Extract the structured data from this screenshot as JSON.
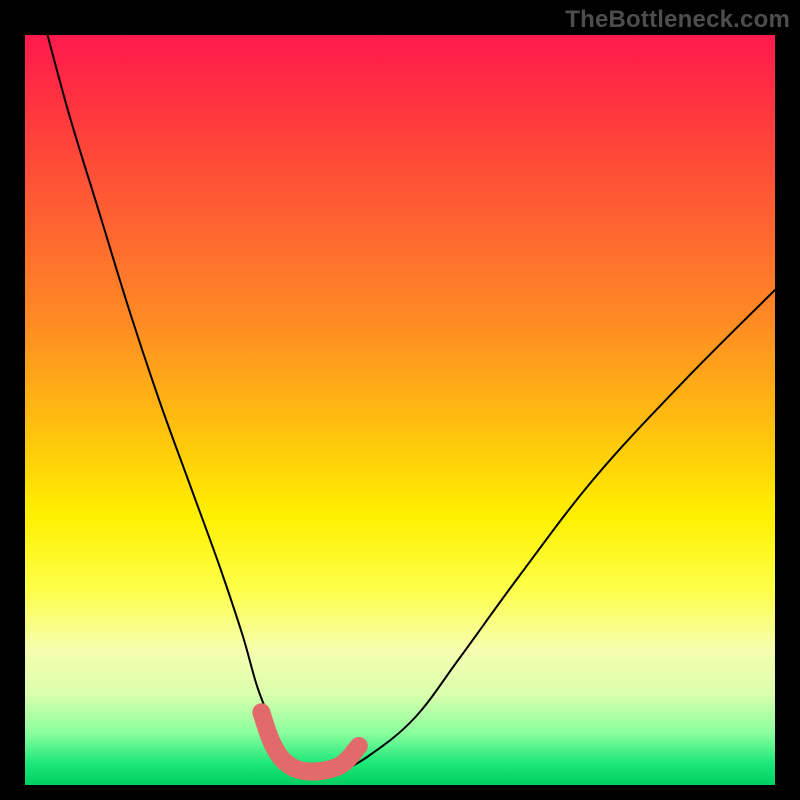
{
  "watermark": "TheBottleneck.com",
  "chart_data": {
    "type": "line",
    "title": "",
    "xlabel": "",
    "ylabel": "",
    "xlim": [
      0,
      100
    ],
    "ylim": [
      0,
      100
    ],
    "grid": false,
    "legend": false,
    "background": "vertical-rainbow-gradient",
    "series": [
      {
        "name": "bottleneck-curve",
        "color": "#000000",
        "x": [
          3,
          6,
          10,
          14,
          18,
          22,
          26,
          29,
          31,
          33,
          35,
          38,
          42,
          46,
          52,
          58,
          66,
          76,
          88,
          100
        ],
        "y": [
          100,
          89,
          76,
          63,
          51,
          40,
          29,
          20,
          13,
          8,
          4,
          2,
          2,
          4,
          9,
          17,
          28,
          41,
          54,
          66
        ]
      }
    ],
    "annotations": [
      {
        "name": "optimal-range-marker",
        "type": "marker-band",
        "color": "#e26a6a",
        "x": [
          31.5,
          33,
          35,
          38,
          42,
          44.5
        ],
        "y": [
          9.7,
          5.5,
          2.8,
          1.8,
          2.6,
          5.2
        ]
      }
    ],
    "gradient_stops": [
      {
        "pos": 0.0,
        "color": "#ff1a4d"
      },
      {
        "pos": 0.22,
        "color": "#ff5a34"
      },
      {
        "pos": 0.52,
        "color": "#ffbf0f"
      },
      {
        "pos": 0.74,
        "color": "#fdff4a"
      },
      {
        "pos": 0.93,
        "color": "#8cff9e"
      },
      {
        "pos": 1.0,
        "color": "#00d060"
      }
    ]
  }
}
